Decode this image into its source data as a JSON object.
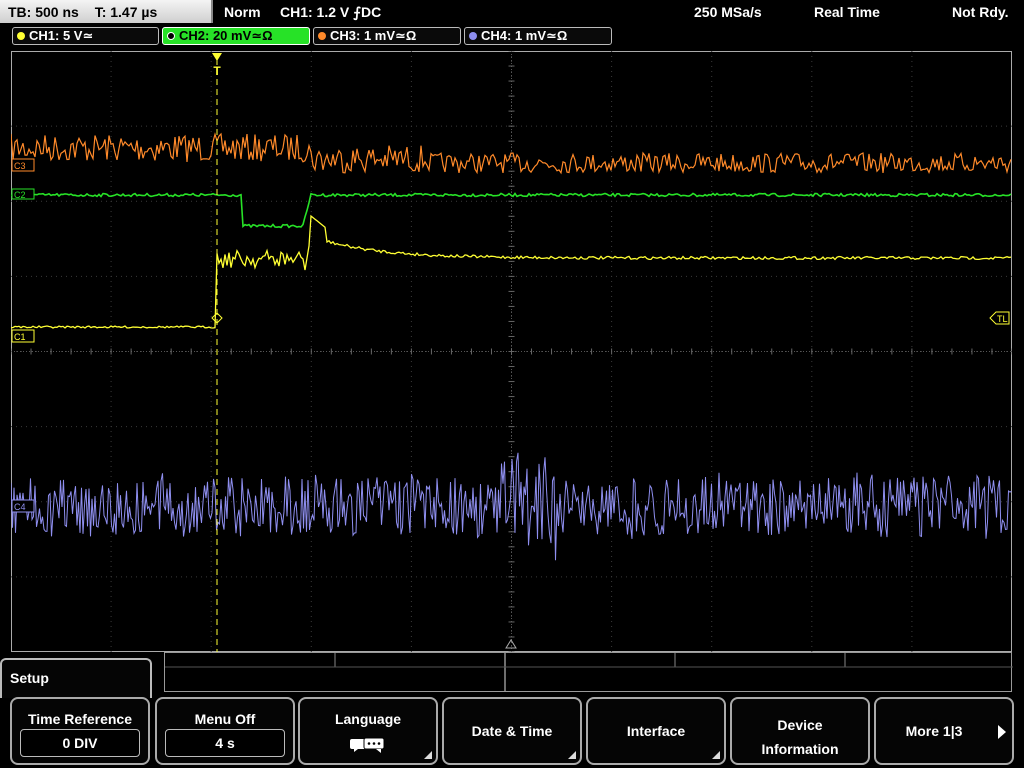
{
  "status": {
    "timebase": "TB: 500 ns",
    "trigger_time": "T: 1.47 µs",
    "mode": "Norm",
    "trigger": "CH1: 1.2 V ⨍DC",
    "sample_rate": "250 MSa/s",
    "acq_mode": "Real Time",
    "ready": "Not Rdy."
  },
  "channels": [
    {
      "label": "CH1: 5 V≃",
      "color": "#ffff33"
    },
    {
      "label": "CH2: 20 mV≃Ω",
      "color": "#27e227"
    },
    {
      "label": "CH3: 1 mV≃Ω",
      "color": "#ff8a2a"
    },
    {
      "label": "CH4: 1 mV≃Ω",
      "color": "#8f8ff0"
    }
  ],
  "markers": {
    "ch3": "C3",
    "ch2": "C2",
    "ch1": "C1",
    "ch4": "C4",
    "trigger_level": "TL",
    "trigger_pos": "T"
  },
  "menu": {
    "setup": "Setup",
    "time_reference": {
      "title": "Time Reference",
      "value": "0 DIV"
    },
    "menu_off": {
      "title": "Menu Off",
      "value": "4 s"
    },
    "language": {
      "title": "Language",
      "icon": "speech-bubbles-icon"
    },
    "date_time": "Date & Time",
    "interface": "Interface",
    "device_info_1": "Device",
    "device_info_2": "Information",
    "more": "More 1|3"
  }
}
